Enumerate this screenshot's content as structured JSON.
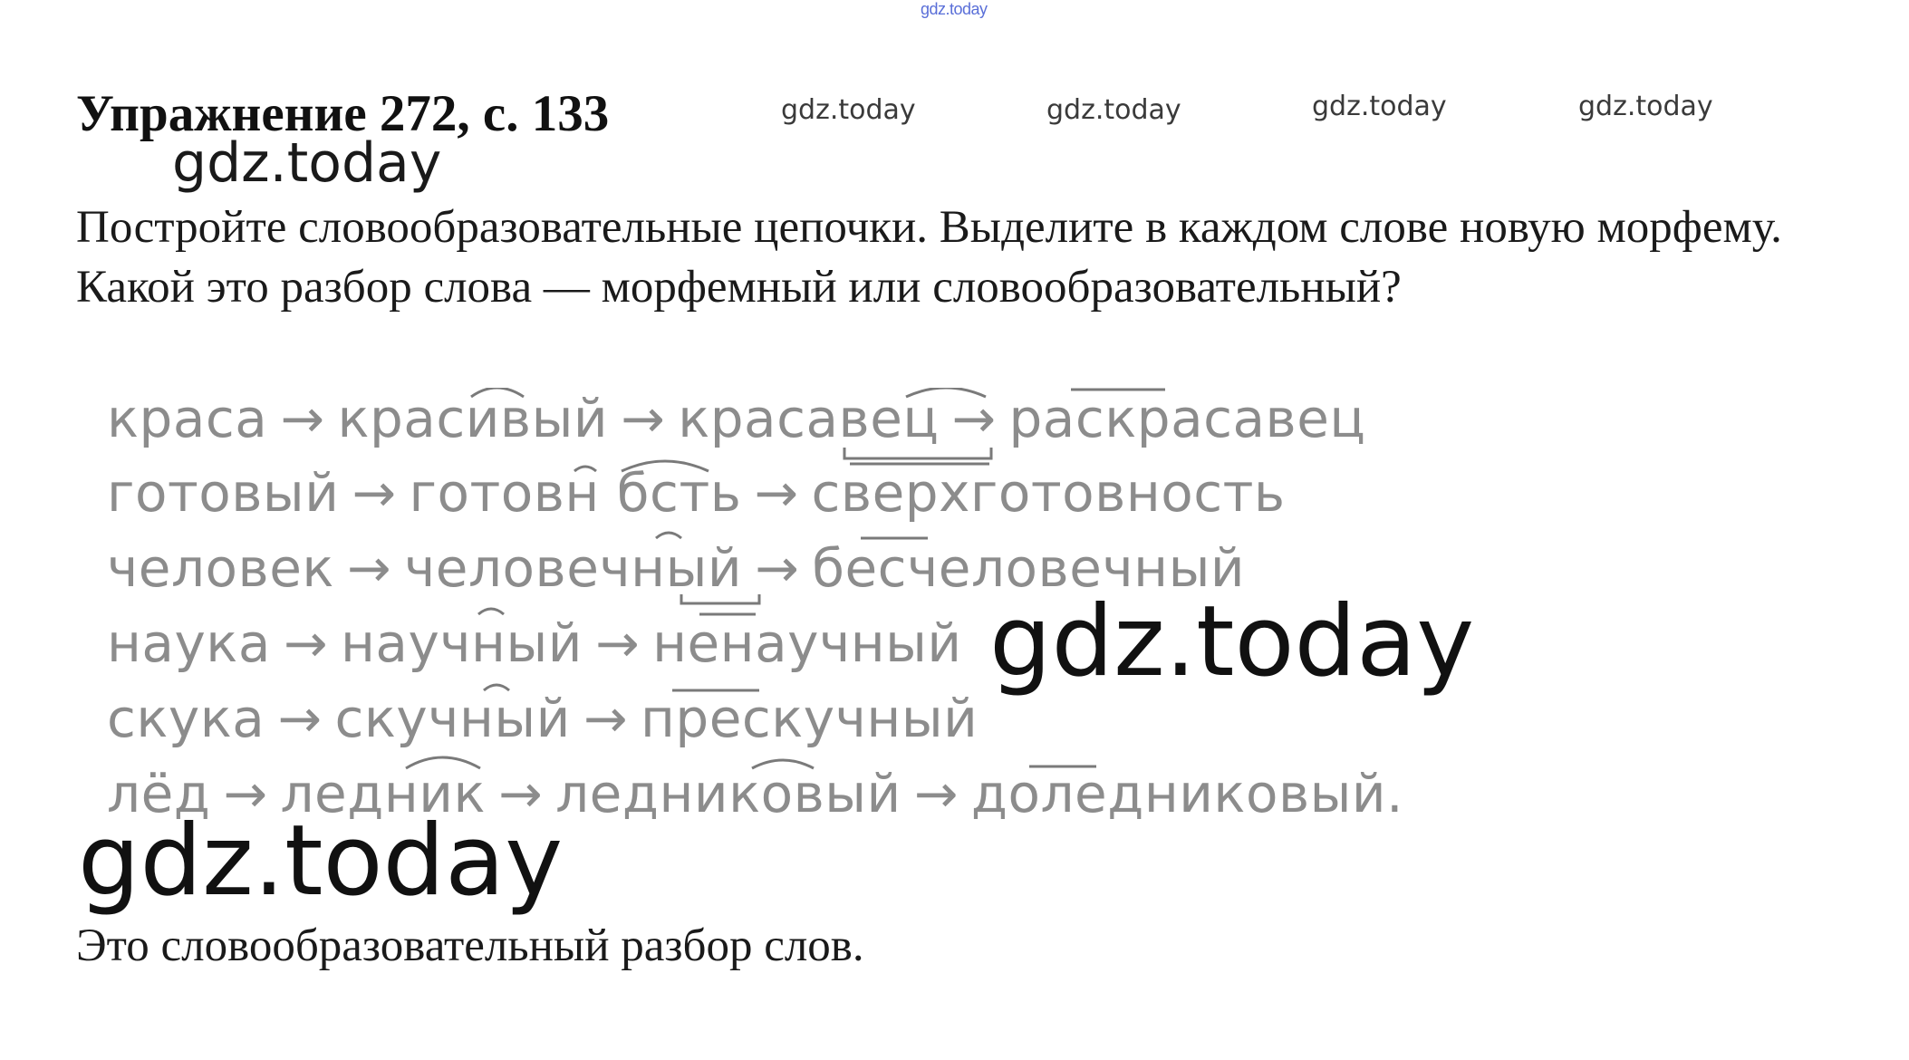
{
  "watermark_text": "gdz.today",
  "header": {
    "title": "Упражнение 272, с. 133"
  },
  "task": {
    "text": "Постройте словообразовательные цепочки. Выделите в каждом слове новую морфему. Какой это разбор слова — морфемный или словообразовательный?"
  },
  "chains": [
    [
      "краса",
      "красивый",
      "красавец",
      "раскрасавец"
    ],
    [
      "готовый",
      "готовн бсть",
      "сверхготовность"
    ],
    [
      "человек",
      "человечный",
      "бесчеловечный"
    ],
    [
      "наука",
      "научный",
      "ненаучный"
    ],
    [
      "скука",
      "скучный",
      "прескучный"
    ],
    [
      "лёд",
      "ледник",
      "ледниковый",
      "доледниковый."
    ]
  ],
  "arrow": "→",
  "answer": {
    "text": "Это словообразовательный разбор слов."
  }
}
